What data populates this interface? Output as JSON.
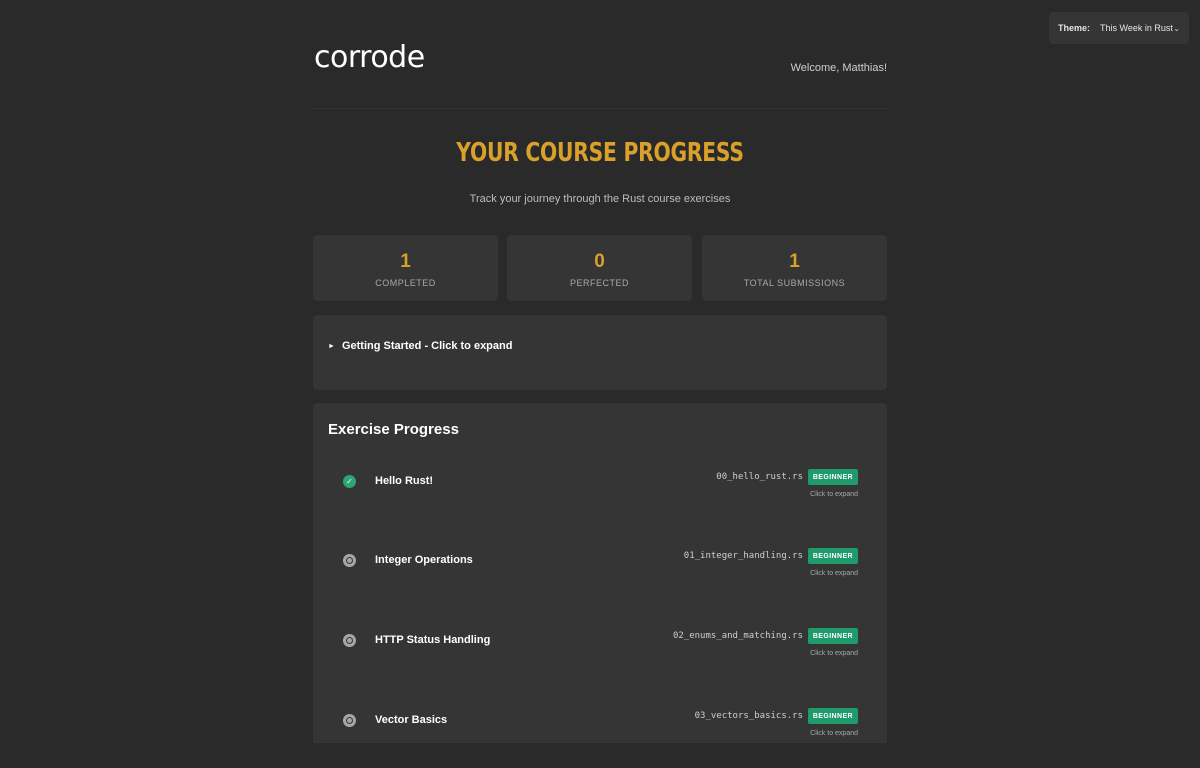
{
  "theme": {
    "label": "Theme:",
    "value": "This Week in Rust",
    "chevron": "chevron-down-icon"
  },
  "header": {
    "logo": "corrode",
    "welcome": "Welcome, Matthias!"
  },
  "hero": {
    "title": "YOUR COURSE PROGRESS",
    "subtitle": "Track your journey through the Rust course exercises"
  },
  "stats": [
    {
      "value": "1",
      "label": "COMPLETED"
    },
    {
      "value": "0",
      "label": "PERFECTED"
    },
    {
      "value": "1",
      "label": "TOTAL SUBMISSIONS"
    }
  ],
  "getting_started": {
    "label": "Getting Started - Click to expand",
    "icon": "triangle-right-icon"
  },
  "exercises": {
    "heading": "Exercise Progress",
    "items": [
      {
        "title": "Hello Rust!",
        "file": "00_hello_rust.rs",
        "level": "BEGINNER",
        "hint": "Click to expand",
        "status": "completed"
      },
      {
        "title": "Integer Operations",
        "file": "01_integer_handling.rs",
        "level": "BEGINNER",
        "hint": "Click to expand",
        "status": "pending"
      },
      {
        "title": "HTTP Status Handling",
        "file": "02_enums_and_matching.rs",
        "level": "BEGINNER",
        "hint": "Click to expand",
        "status": "pending"
      },
      {
        "title": "Vector Basics",
        "file": "03_vectors_basics.rs",
        "level": "BEGINNER",
        "hint": "Click to expand",
        "status": "pending"
      }
    ]
  },
  "colors": {
    "accent": "#d9a02a",
    "badge": "#1e9a6b",
    "done": "#2aa774",
    "pending": "#a6a6a6",
    "background": "#2a2a2a",
    "card": "#353535"
  }
}
